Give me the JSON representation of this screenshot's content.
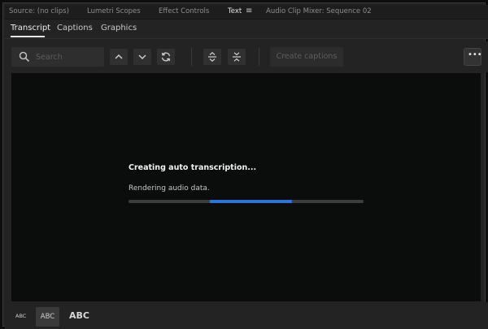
{
  "panel_tabs": [
    {
      "label": "Source: (no clips)",
      "active": false
    },
    {
      "label": "Lumetri Scopes",
      "active": false
    },
    {
      "label": "Effect Controls",
      "active": false
    },
    {
      "label": "Text",
      "active": true
    },
    {
      "label": "Audio Clip Mixer: Sequence 02",
      "active": false
    }
  ],
  "sub_tabs": [
    {
      "label": "Transcript",
      "active": true
    },
    {
      "label": "Captions",
      "active": false
    },
    {
      "label": "Graphics",
      "active": false
    }
  ],
  "toolbar": {
    "search_placeholder": "Search",
    "create_captions_label": "Create captions",
    "more_label": "•••",
    "icons": [
      "search-icon",
      "chevron-up-icon",
      "chevron-down-icon",
      "refresh-icon",
      "expand-icon",
      "collapse-icon",
      "more-icon"
    ]
  },
  "status": {
    "title": "Creating auto transcription...",
    "detail": "Rendering audio data.",
    "progress_start": 0.345,
    "progress_end": 0.695,
    "accent_color": "#2b73d9"
  },
  "text_size": {
    "small": "ABC",
    "medium": "ABC",
    "large": "ABC",
    "selected": "medium"
  }
}
